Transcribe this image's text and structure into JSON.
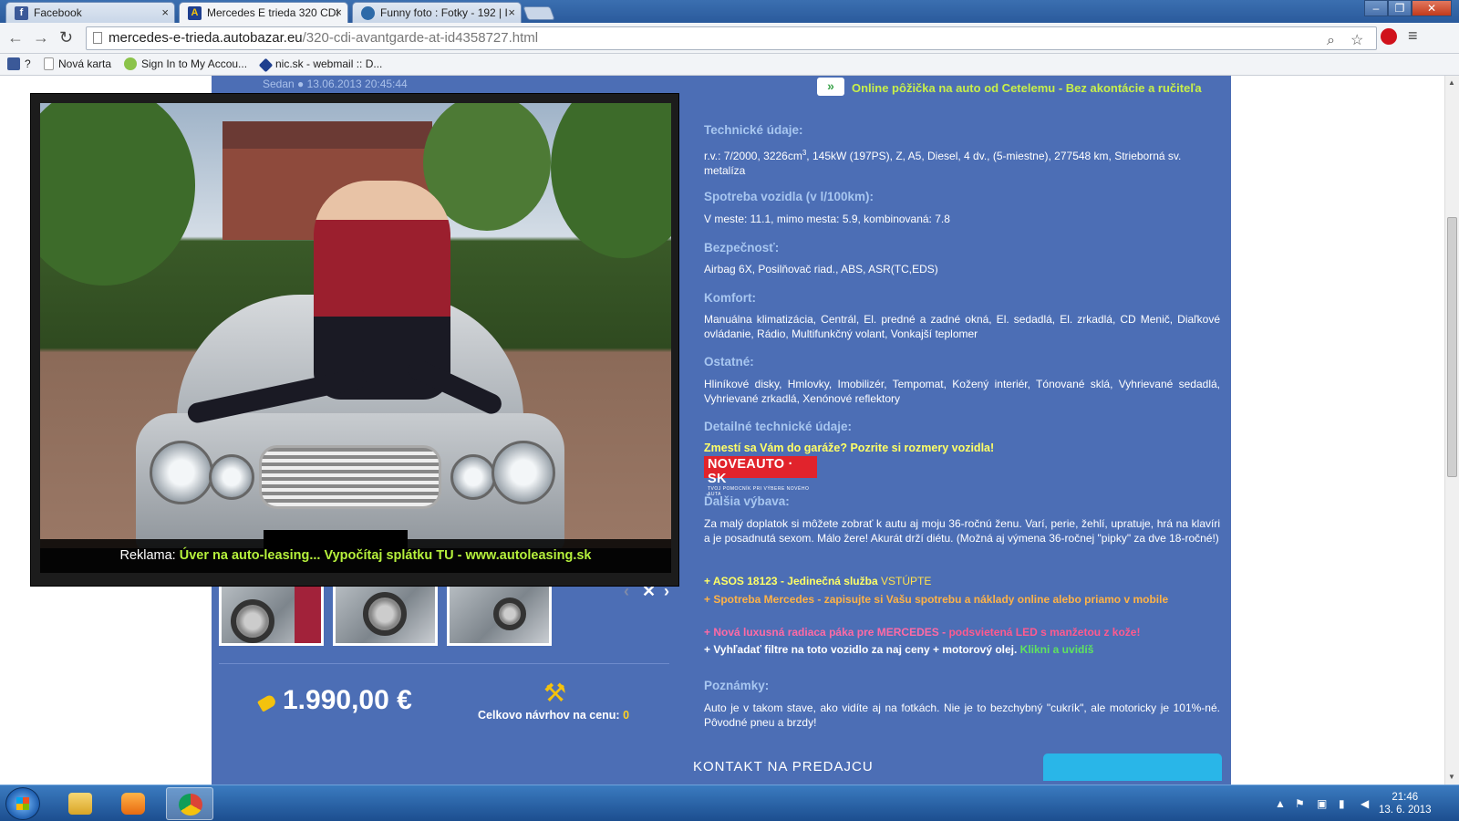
{
  "browser": {
    "tabs": [
      {
        "title": "Facebook",
        "icon": "facebook-icon",
        "color": "#3b5998"
      },
      {
        "title": "Mercedes E trieda 320 CDI",
        "icon": "autobazar-icon",
        "color": "#1e3f8f"
      },
      {
        "title": "Funny foto : Fotky - 192 | I",
        "icon": "globe-icon",
        "color": "#2d6aa8"
      }
    ],
    "url_host": "mercedes-e-trieda.autobazar.eu",
    "url_path": "/320-cdi-avantgarde-at-id4358727.html",
    "bookmarks": [
      {
        "label": "?",
        "icon": "facebook-icon"
      },
      {
        "label": "Nová karta",
        "icon": "page-icon"
      },
      {
        "label": "Sign In to My Accou...",
        "icon": "green-sign-icon"
      },
      {
        "label": "nic.sk - webmail :: D...",
        "icon": "nic-icon"
      }
    ]
  },
  "listing": {
    "body_type": "Sedan",
    "date": "13.06.2013 20:45:44",
    "loan_text": "Online pôžička na auto od Cetelemu - Bez akontácie a ručiteľa",
    "tech_heading": "Technické údaje:",
    "tech_text_a": "r.v.: 7/2000, 3226cm",
    "tech_sup": "3",
    "tech_text_b": ", 145kW (197PS), Z, A5, Diesel, 4 dv., (5-miestne), 277548 km, Strieborná sv. metalíza",
    "consumption_heading": "Spotreba vozidla (v l/100km):",
    "consumption_text": "V meste: 11.1, mimo mesta: 5.9, kombinovaná: 7.8",
    "safety_heading": "Bezpečnosť:",
    "safety_text": "Airbag 6X, Posilňovač riad., ABS, ASR(TC,EDS)",
    "comfort_heading": "Komfort:",
    "comfort_text": "Manuálna klimatizácia, Centrál, El. predné a zadné okná, El. sedadlá, El. zrkadlá, CD Menič, Diaľkové ovládanie, Rádio, Multifunkčný volant, Vonkajší teplomer",
    "other_heading": "Ostatné:",
    "other_text": "Hliníkové disky, Hmlovky, Imobilizér, Tempomat, Kožený interiér, Tónované sklá, Vyhrievané sedadlá, Vyhrievané zrkadlá, Xenónové reflektory",
    "detail_heading": "Detailné technické údaje:",
    "garage_link": "Zmestí sa Vám do garáže? Pozrite si rozmery vozidla!",
    "noveauto_logo": "NOVEAUTO · SK",
    "noveauto_tagline": "TVOJ POMOCNÍK PRI VÝBERE NOVÉHO AUTA",
    "extra_heading": "Ďalšia výbava:",
    "extra_text": "Za malý doplatok si môžete zobrať k autu aj moju 36-ročnú ženu. Varí, perie, žehlí, upratuje, hrá na klavíri a je posadnutá sexom. Málo žere! Akurát drží diétu. (Možná aj výmena 36-ročnej \"pipky\" za dve 18-ročné!)",
    "promo1_a": "+ ASOS 18123 - Jedinečná služba ",
    "promo1_b": "VSTÚPTE",
    "promo2": "+ Spotreba Mercedes - zapisujte si Vašu spotrebu a náklady online alebo priamo v mobile",
    "promo3_a": "+ Nová luxusná radiaca páka pre MERCEDES - ",
    "promo3_b": "podsvietená LED s manžetou z kože!",
    "promo4_a": "+ Vyhľadať filtre na toto vozidlo za naj ceny + motorový olej. ",
    "promo4_b": "Klikni a uvidíš",
    "notes_heading": "Poznámky:",
    "notes_text": "Auto je v takom stave, ako vidíte aj na fotkách. Nie je to bezchybný \"cukrík\", ale motoricky je 101%-né. Pôvodné pneu a brzdy!",
    "price": "1.990,00 €",
    "offers_label": "Celkovo návrhov na cenu:",
    "offers_count": "0",
    "contact_heading": "KONTAKT NA PREDAJCU"
  },
  "lightbox": {
    "ad_label": "Reklama:",
    "ad_link": "Úver na auto-leasing... Vypočítaj splátku TU - www.autoleasing.sk",
    "prev": "‹",
    "close": "✕",
    "next": "›"
  },
  "taskbar": {
    "time": "21:46",
    "date": "13. 6. 2013"
  }
}
